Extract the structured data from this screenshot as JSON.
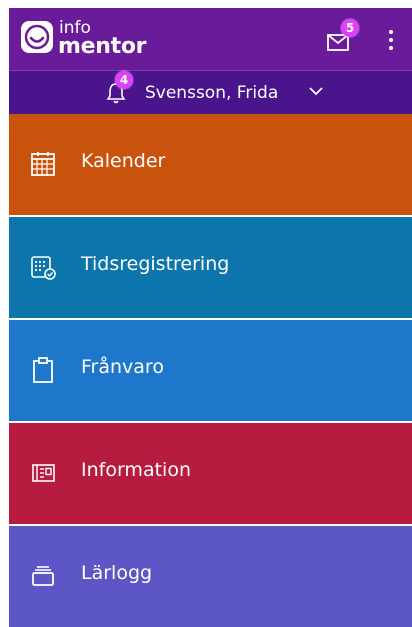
{
  "header": {
    "logo_top": "info",
    "logo_bottom": "mentor",
    "mail_badge": "5",
    "bell_badge": "4",
    "user_name": "Svensson, Frida"
  },
  "menu": [
    {
      "label": "Kalender",
      "icon": "calendar-icon",
      "color": "#c9520d"
    },
    {
      "label": "Tidsregistrering",
      "icon": "time-registration-icon",
      "color": "#0c75ac"
    },
    {
      "label": "Frånvaro",
      "icon": "clipboard-icon",
      "color": "#1e77cb"
    },
    {
      "label": "Information",
      "icon": "newspaper-icon",
      "color": "#b71b40"
    },
    {
      "label": "Lärlogg",
      "icon": "learning-log-icon",
      "color": "#5c56c6"
    }
  ],
  "colors": {
    "topbar": "#6a1b9a",
    "userbar": "#4a148c",
    "badge": "#e040fb"
  }
}
